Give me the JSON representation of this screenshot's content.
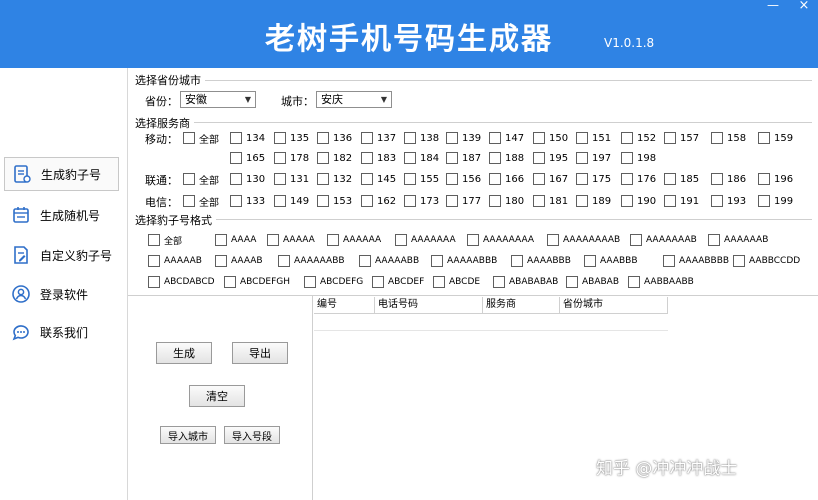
{
  "window": {
    "title": "老树手机号码生成器",
    "version": "V1.0.1.8",
    "minimize_glyph": "—",
    "close_glyph": "×"
  },
  "sidebar": {
    "items": [
      {
        "label": "生成豹子号",
        "icon": "document-list-icon"
      },
      {
        "label": "生成随机号",
        "icon": "calendar-icon"
      },
      {
        "label": "自定义豹子号",
        "icon": "edit-document-icon"
      },
      {
        "label": "登录软件",
        "icon": "user-icon"
      },
      {
        "label": "联系我们",
        "icon": "chat-bubble-icon"
      }
    ]
  },
  "region": {
    "group_title": "选择省份城市",
    "province_label": "省份：",
    "province_value": "安徽",
    "city_label": "城市：",
    "city_value": "安庆"
  },
  "carrier": {
    "group_title": "选择服务商",
    "all_label": "全部",
    "mobile": {
      "label": "移动：",
      "row1": [
        "134",
        "135",
        "136",
        "137",
        "138",
        "139",
        "147",
        "150",
        "151",
        "152",
        "157",
        "158",
        "159"
      ],
      "row2": [
        "165",
        "178",
        "182",
        "183",
        "184",
        "187",
        "188",
        "195",
        "197",
        "198"
      ]
    },
    "unicom": {
      "label": "联通：",
      "row1": [
        "130",
        "131",
        "132",
        "145",
        "155",
        "156",
        "166",
        "167",
        "175",
        "176",
        "185",
        "186",
        "196"
      ]
    },
    "telecom": {
      "label": "电信：",
      "row1": [
        "133",
        "149",
        "153",
        "162",
        "173",
        "177",
        "180",
        "181",
        "189",
        "190",
        "191",
        "193",
        "199"
      ]
    }
  },
  "format": {
    "group_title": "选择豹子号格式",
    "row1": [
      "全部",
      "AAAA",
      "AAAAA",
      "AAAAAA",
      "AAAAAAA",
      "AAAAAAAA",
      "AAAAAAAAB",
      "AAAAAAAB",
      "AAAAAAB"
    ],
    "row2": [
      "AAAAAB",
      "AAAAB",
      "AAAAAABB",
      "AAAAABB",
      "AAAAABBB",
      "AAAABBB",
      "AAABBB",
      "AAAABBBB",
      "AABBCCDD"
    ],
    "row3": [
      "ABCDABCD",
      "ABCDEFGH",
      "ABCDEFG",
      "ABCDEF",
      "ABCDE",
      "ABABABAB",
      "ABABAB",
      "AABBAABB"
    ]
  },
  "actions": {
    "generate": "生成",
    "export": "导出",
    "clear": "清空",
    "import_city": "导入城市",
    "import_segment": "导入号段"
  },
  "table": {
    "columns": [
      "编号",
      "电话号码",
      "服务商",
      "省份城市"
    ]
  },
  "watermark": "知乎 @冲冲冲战士",
  "colors": {
    "header": "#2f83e4"
  }
}
